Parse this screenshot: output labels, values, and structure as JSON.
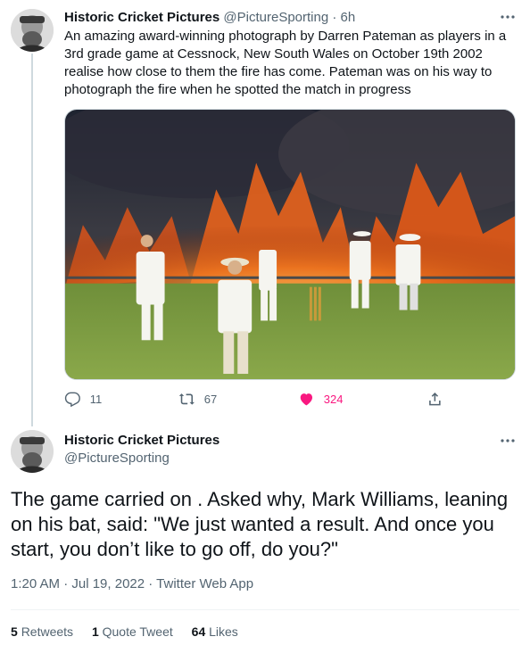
{
  "tweet": {
    "display_name": "Historic Cricket Pictures",
    "handle": "@PictureSporting",
    "separator": "·",
    "time": "6h",
    "text": "An amazing award-winning photograph by Darren Pateman as players in a 3rd grade game at Cessnock, New South Wales on October 19th 2002 realise how close to them the fire has come.  Pateman was on his way to photograph the fire when he spotted the match in progress",
    "replies": "11",
    "retweets": "67",
    "likes": "324",
    "icons": [
      "more-icon",
      "reply-icon",
      "retweet-icon",
      "like-icon",
      "share-icon"
    ]
  },
  "reply": {
    "display_name": "Historic Cricket Pictures",
    "handle": "@PictureSporting",
    "text": "The game carried on . Asked why, Mark Williams, leaning on his bat, said: \"We just wanted a result. And once you start, you don’t like to go off, do you?\"",
    "timestamp": "1:20 AM · Jul 19, 2022 · Twitter Web App",
    "stats": {
      "retweets_count": "5",
      "retweets_label": "Retweets",
      "quotes_count": "1",
      "quotes_label": "Quote Tweet",
      "likes_count": "64",
      "likes_label": "Likes"
    }
  },
  "colors": {
    "like_pink": "#f91880",
    "secondary_text": "#536471",
    "primary_text": "#0f1419"
  }
}
